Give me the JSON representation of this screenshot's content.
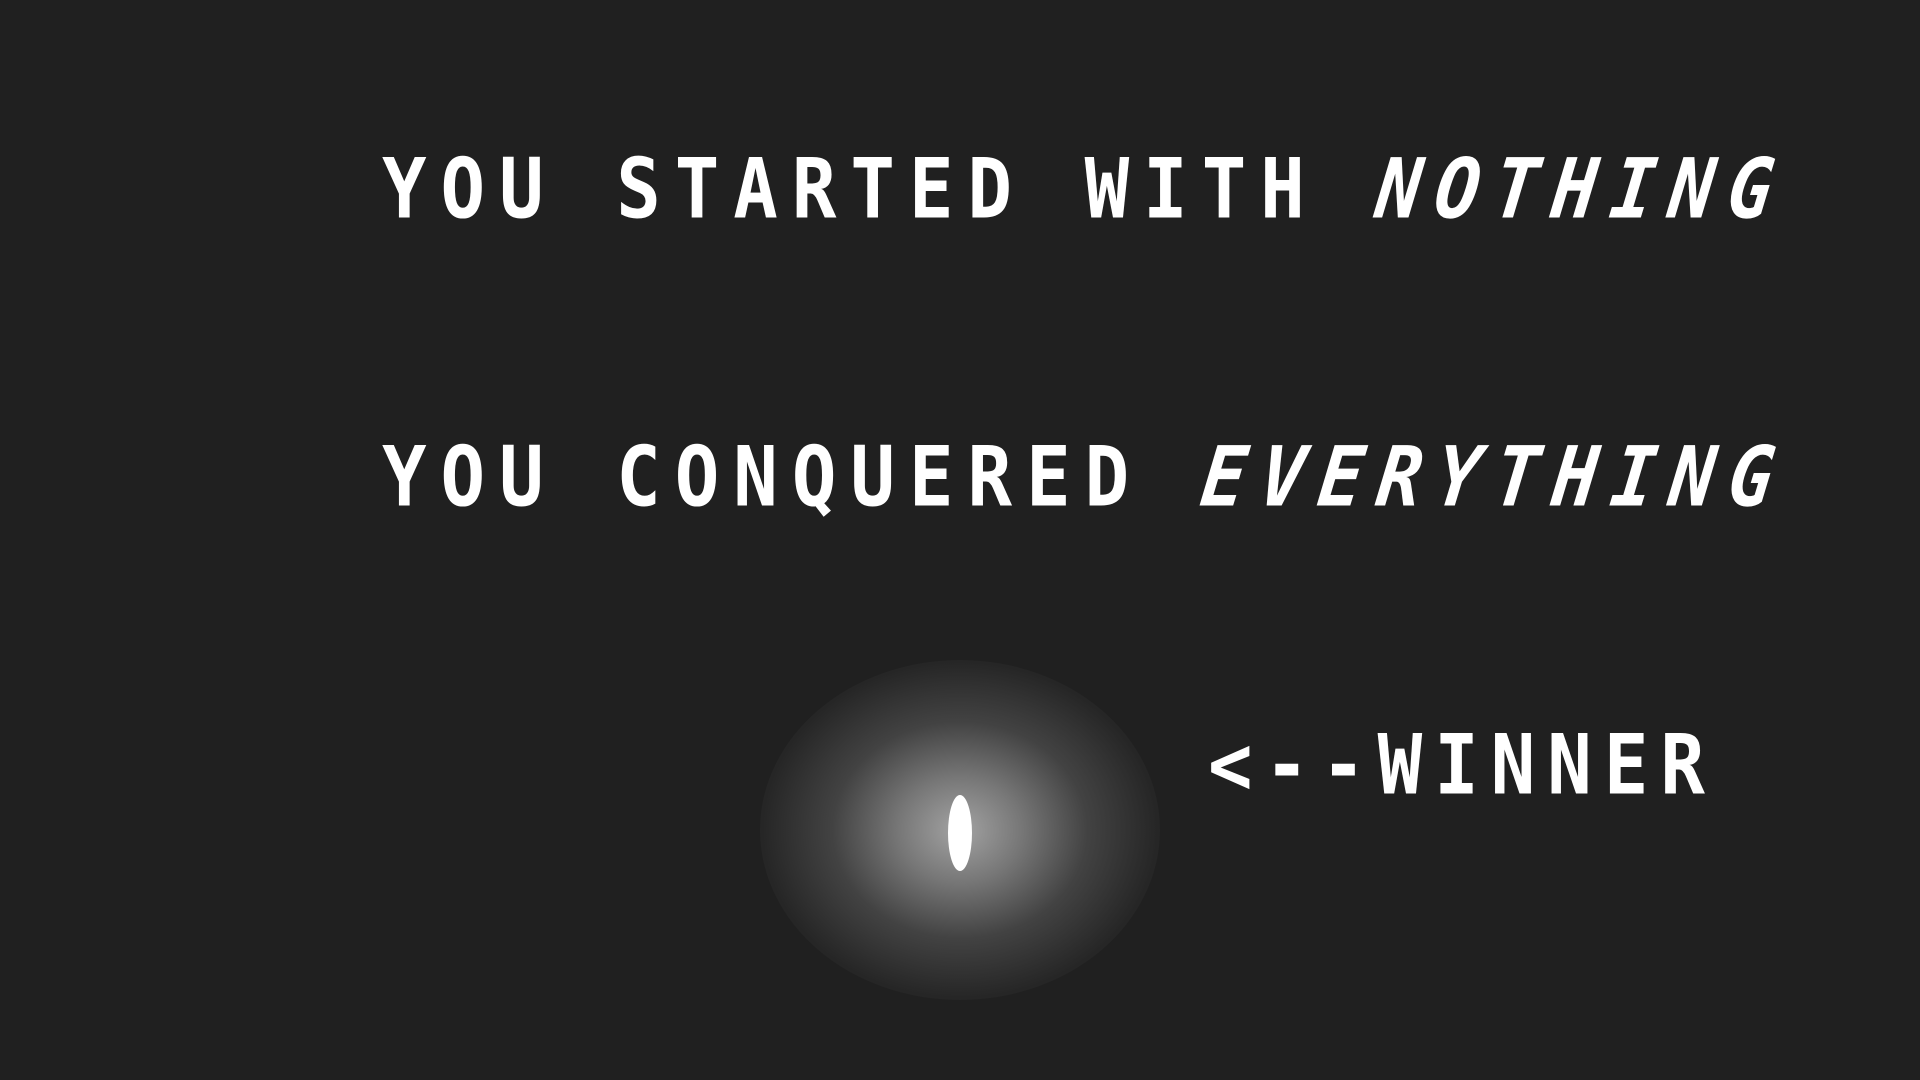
{
  "ending": {
    "line1": {
      "prefix": "YOU STARTED WITH ",
      "emphasis": "NOTHING"
    },
    "line2": {
      "prefix": "YOU CONQUERED ",
      "emphasis": "EVERYTHING"
    },
    "winner_label": "<--WINNER"
  },
  "colors": {
    "background": "#202020",
    "text": "#ffffff",
    "glow": "#aaaaaa",
    "player": "#ffffff"
  }
}
